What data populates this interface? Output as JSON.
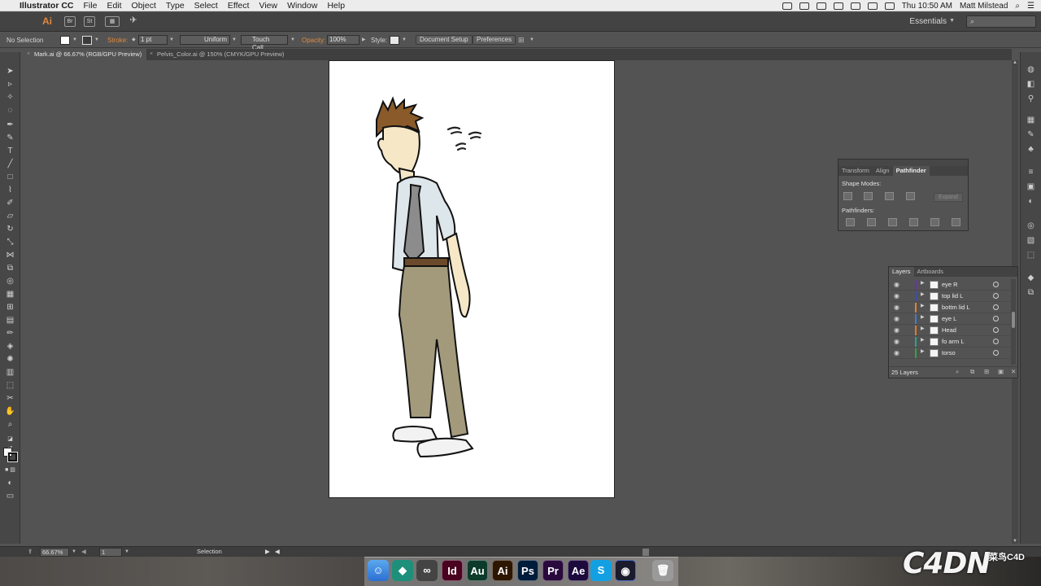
{
  "menubar": {
    "app_name": "Illustrator CC",
    "items": [
      "File",
      "Edit",
      "Object",
      "Type",
      "Select",
      "Effect",
      "View",
      "Window",
      "Help"
    ],
    "clock": "Thu 10:50 AM",
    "user": "Matt Milstead"
  },
  "appbar": {
    "logo": "Ai",
    "bridge_label": "Br",
    "stock_label": "St",
    "workspace": "Essentials"
  },
  "control": {
    "selection": "No Selection",
    "stroke_label": "Stroke:",
    "stroke_weight": "1 pt",
    "profile": "Uniform",
    "brush": "Touch Call...",
    "opacity_label": "Opacity:",
    "opacity_value": "100%",
    "style_label": "Style:",
    "document_setup": "Document Setup",
    "preferences": "Preferences"
  },
  "tabs": [
    {
      "label": "Mark.ai @ 66.67% (RGB/GPU Preview)",
      "active": true
    },
    {
      "label": "Pelvis_Color.ai @ 150% (CMYK/GPU Preview)",
      "active": false
    }
  ],
  "pathfinder": {
    "tabs": [
      "Transform",
      "Align",
      "Pathfinder"
    ],
    "shape_modes": "Shape Modes:",
    "pathfinders": "Pathfinders:",
    "expand": "Expand"
  },
  "layers": {
    "tabs": [
      "Layers",
      "Artboards"
    ],
    "rows": [
      {
        "name": "eye R",
        "color": "#6a2fc0"
      },
      {
        "name": "top lid L",
        "color": "#2e4bd0"
      },
      {
        "name": "bottm lid L",
        "color": "#e5802f"
      },
      {
        "name": "eye L",
        "color": "#3e7fd0"
      },
      {
        "name": "Head",
        "color": "#e6762a"
      },
      {
        "name": "fo arm L",
        "color": "#2aa58a"
      },
      {
        "name": "torso",
        "color": "#32a24a"
      }
    ],
    "count": "25 Layers"
  },
  "status": {
    "zoom": "66.67%",
    "artboard": "1",
    "tool": "Selection"
  },
  "dock_apps": [
    {
      "label": "Id",
      "color": "#49021f"
    },
    {
      "label": "Au",
      "color": "#0d3b2b"
    },
    {
      "label": "Ai",
      "color": "#2d1600"
    },
    {
      "label": "Ps",
      "color": "#001c3b"
    },
    {
      "label": "Pr",
      "color": "#2a0a3d"
    },
    {
      "label": "Ae",
      "color": "#1d0a3d"
    }
  ],
  "watermark": {
    "text": "C4D",
    "suffix": "N",
    "sub": "菜鸟C4D"
  }
}
